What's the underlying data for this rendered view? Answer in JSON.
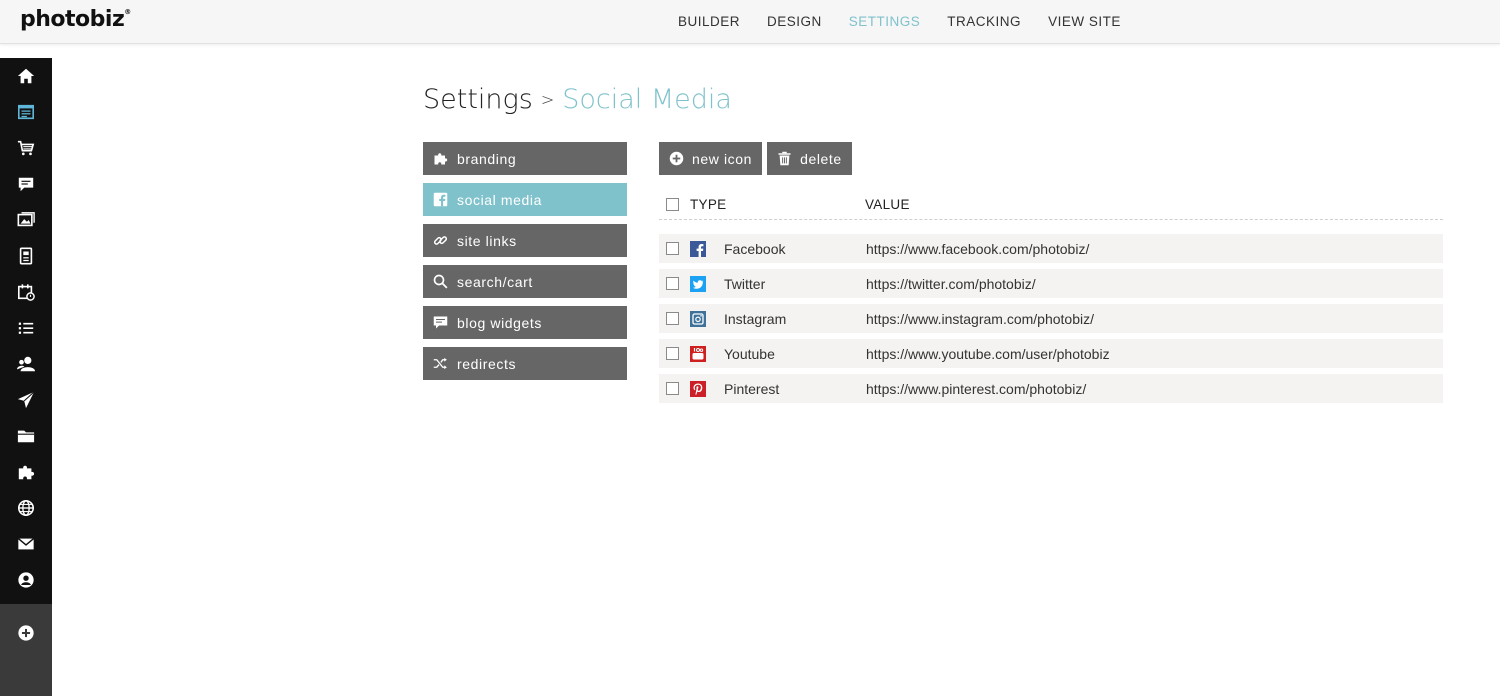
{
  "app": {
    "logo": "photobiz"
  },
  "nav": [
    {
      "label": "BUILDER",
      "active": false
    },
    {
      "label": "DESIGN",
      "active": false
    },
    {
      "label": "SETTINGS",
      "active": true
    },
    {
      "label": "TRACKING",
      "active": false
    },
    {
      "label": "VIEW SITE",
      "active": false
    }
  ],
  "sidebar_icons": [
    "home-icon",
    "calendar-list-icon",
    "cart-icon",
    "chat-icon",
    "gallery-icon",
    "document-icon",
    "event-calendar-icon",
    "list-icon",
    "users-icon",
    "send-icon",
    "folder-icon",
    "puzzle-icon",
    "globe-icon",
    "mail-icon",
    "account-icon",
    "add-icon"
  ],
  "breadcrumb": {
    "root": "Settings",
    "separator": ">",
    "current": "Social Media"
  },
  "menu": [
    {
      "label": "branding",
      "icon": "puzzle-icon",
      "active": false
    },
    {
      "label": "social media",
      "icon": "facebook-icon",
      "active": true
    },
    {
      "label": "site links",
      "icon": "link-icon",
      "active": false
    },
    {
      "label": "search/cart",
      "icon": "search-icon",
      "active": false
    },
    {
      "label": "blog widgets",
      "icon": "comment-icon",
      "active": false
    },
    {
      "label": "redirects",
      "icon": "shuffle-icon",
      "active": false
    }
  ],
  "toolbar": {
    "new_label": "new icon",
    "delete_label": "delete"
  },
  "table": {
    "headers": {
      "type": "TYPE",
      "value": "VALUE"
    },
    "rows": [
      {
        "type": "Facebook",
        "value": "https://www.facebook.com/photobiz/",
        "icon": "facebook-icon",
        "color": "#3b5998"
      },
      {
        "type": "Twitter",
        "value": "https://twitter.com/photobiz/",
        "icon": "twitter-icon",
        "color": "#1da1f2"
      },
      {
        "type": "Instagram",
        "value": "https://www.instagram.com/photobiz/",
        "icon": "instagram-icon",
        "color": "#3f729b"
      },
      {
        "type": "Youtube",
        "value": "https://www.youtube.com/user/photobiz",
        "icon": "youtube-icon",
        "color": "#cd201f"
      },
      {
        "type": "Pinterest",
        "value": "https://www.pinterest.com/photobiz/",
        "icon": "pinterest-icon",
        "color": "#cb2027"
      }
    ]
  },
  "colors": {
    "accent": "#7fc2cc",
    "button": "#666666",
    "sidebar": "#111111"
  }
}
